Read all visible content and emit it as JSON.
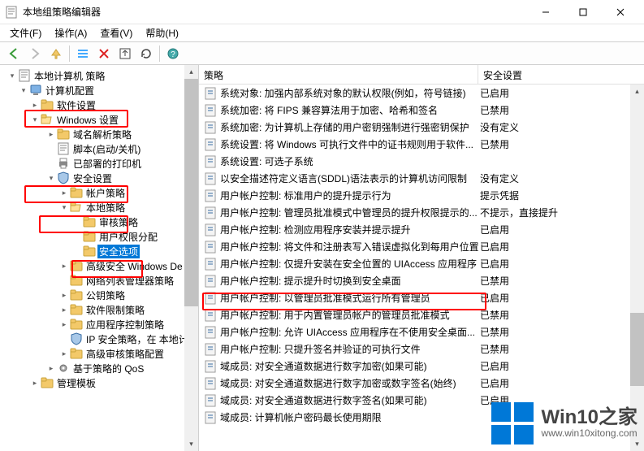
{
  "window": {
    "title": "本地组策略编辑器"
  },
  "menu": {
    "file": "文件(F)",
    "action": "操作(A)",
    "view": "查看(V)",
    "help": "帮助(H)"
  },
  "tree": {
    "root": {
      "label": "本地计算机 策略"
    },
    "cc": {
      "label": "计算机配置"
    },
    "sw": {
      "label": "软件设置"
    },
    "winset": {
      "label": "Windows 设置"
    },
    "dns": {
      "label": "域名解析策略"
    },
    "script": {
      "label": "脚本(启动/关机)"
    },
    "printers": {
      "label": "已部署的打印机"
    },
    "secset": {
      "label": "安全设置"
    },
    "acct": {
      "label": "帐户策略"
    },
    "local": {
      "label": "本地策略"
    },
    "audit": {
      "label": "审核策略"
    },
    "rights": {
      "label": "用户权限分配"
    },
    "secopt": {
      "label": "安全选项"
    },
    "winfw": {
      "label": "高级安全 Windows De"
    },
    "netlist": {
      "label": "网络列表管理器策略"
    },
    "pubkey": {
      "label": "公钥策略"
    },
    "swrestr": {
      "label": "软件限制策略"
    },
    "appctrl": {
      "label": "应用程序控制策略"
    },
    "ipsec": {
      "label": "IP 安全策略，在 本地计"
    },
    "advaudit": {
      "label": "高级审核策略配置"
    },
    "qos": {
      "label": "基于策略的 QoS"
    },
    "mgmttpl": {
      "label": "管理模板"
    }
  },
  "list": {
    "header": {
      "policy": "策略",
      "security": "安全设置"
    },
    "rows": [
      {
        "p": "系统对象: 加强内部系统对象的默认权限(例如，符号链接)",
        "s": "已启用"
      },
      {
        "p": "系统加密: 将 FIPS 兼容算法用于加密、哈希和签名",
        "s": "已禁用"
      },
      {
        "p": "系统加密: 为计算机上存储的用户密钥强制进行强密钥保护",
        "s": "没有定义"
      },
      {
        "p": "系统设置: 将 Windows 可执行文件中的证书规则用于软件...",
        "s": "已禁用"
      },
      {
        "p": "系统设置: 可选子系统",
        "s": ""
      },
      {
        "p": "以安全描述符定义语言(SDDL)语法表示的计算机访问限制",
        "s": "没有定义"
      },
      {
        "p": "用户帐户控制: 标准用户的提升提示行为",
        "s": "提示凭据"
      },
      {
        "p": "用户帐户控制: 管理员批准模式中管理员的提升权限提示的...",
        "s": "不提示，直接提升"
      },
      {
        "p": "用户帐户控制: 检测应用程序安装并提示提升",
        "s": "已启用"
      },
      {
        "p": "用户帐户控制: 将文件和注册表写入错误虚拟化到每用户位置",
        "s": "已启用"
      },
      {
        "p": "用户帐户控制: 仅提升安装在安全位置的 UIAccess 应用程序",
        "s": "已启用"
      },
      {
        "p": "用户帐户控制: 提示提升时切换到安全桌面",
        "s": "已禁用"
      },
      {
        "p": "用户帐户控制: 以管理员批准模式运行所有管理员",
        "s": "已启用"
      },
      {
        "p": "用户帐户控制: 用于内置管理员帐户的管理员批准模式",
        "s": "已禁用"
      },
      {
        "p": "用户帐户控制: 允许 UIAccess 应用程序在不使用安全桌面...",
        "s": "已禁用"
      },
      {
        "p": "用户帐户控制: 只提升签名并验证的可执行文件",
        "s": "已禁用"
      },
      {
        "p": "域成员: 对安全通道数据进行数字加密(如果可能)",
        "s": "已启用"
      },
      {
        "p": "域成员: 对安全通道数据进行数字加密或数字签名(始终)",
        "s": "已启用"
      },
      {
        "p": "域成员: 对安全通道数据进行数字签名(如果可能)",
        "s": "已启用"
      },
      {
        "p": "域成员: 计算机帐户密码最长使用期限",
        "s": ""
      }
    ]
  },
  "watermark": {
    "title": "Win10之家",
    "url": "www.win10xitong.com"
  }
}
